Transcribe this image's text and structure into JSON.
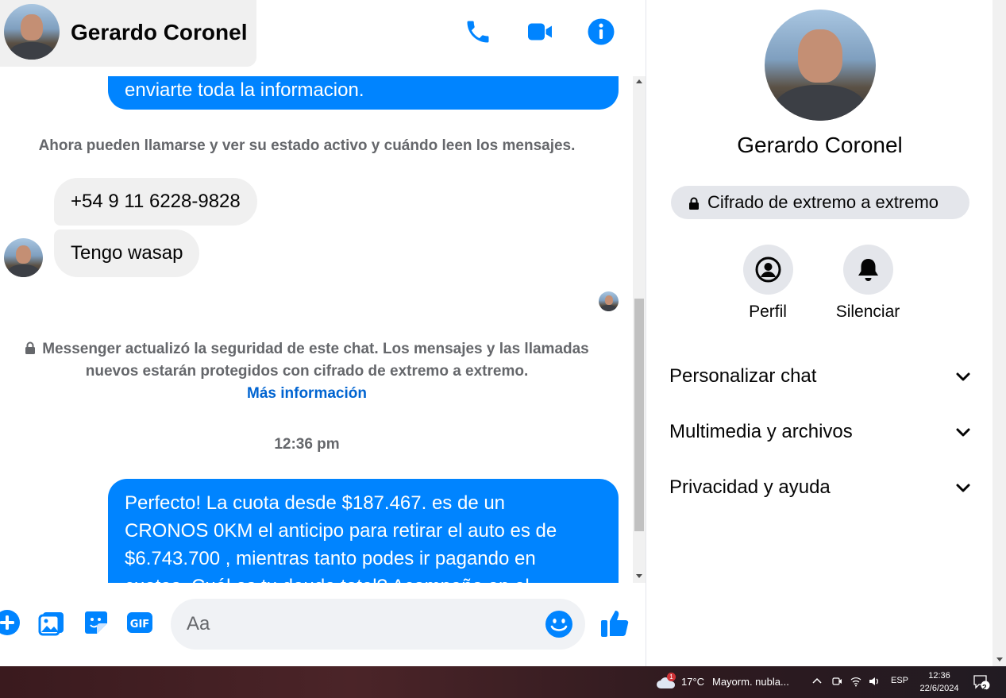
{
  "header": {
    "contact_name": "Gerardo Coronel",
    "icons": [
      "phone-icon",
      "video-call-icon",
      "info-icon"
    ]
  },
  "messages": {
    "outgoing_top_tail": "enviarte toda la informacion.",
    "system_notice": "Ahora pueden llamarse y ver su estado activo y cuándo leen los mensajes.",
    "incoming_phone": "+54 9 11 6228-9828",
    "incoming_text": "Tengo wasap",
    "security_notice_line1": "Messenger actualizó la seguridad de este chat. Los mensajes y las llamadas",
    "security_notice_line2": "nuevos estarán protegidos con cifrado de extremo a extremo.",
    "security_link": "Más información",
    "timestamp": "12:36 pm",
    "outgoing_line1": "Perfecto! La cuota desde $187.467. es de un",
    "outgoing_line2": "CRONOS 0KM el anticipo para retirar el auto es de",
    "outgoing_line3": "$6.743.700 , mientras tanto podes ir pagando en",
    "outgoing_line4": "cuotas. Cuál es tu deuda total? Acompaño en el"
  },
  "composer": {
    "placeholder": "Aa",
    "icons": [
      "plus-icon",
      "gallery-icon",
      "sticker-icon",
      "gif-icon",
      "emoji-icon",
      "like-icon"
    ]
  },
  "info_panel": {
    "name": "Gerardo Coronel",
    "encryption_label": "Cifrado de extremo a extremo",
    "actions": [
      {
        "label": "Perfil",
        "icon": "profile-icon"
      },
      {
        "label": "Silenciar",
        "icon": "bell-icon"
      }
    ],
    "sections": [
      {
        "label": "Personalizar chat"
      },
      {
        "label": "Multimedia y archivos"
      },
      {
        "label": "Privacidad y ayuda"
      }
    ]
  },
  "taskbar": {
    "weather_badge": "1",
    "temperature": "17°C",
    "condition": "Mayorm. nubla...",
    "language": "ESP",
    "time": "12:36",
    "date": "22/6/2024",
    "notifications": "2"
  },
  "colors": {
    "messenger_blue": "#0084ff",
    "link_blue": "#0064d1",
    "bubble_gray": "#f0f0f0"
  }
}
